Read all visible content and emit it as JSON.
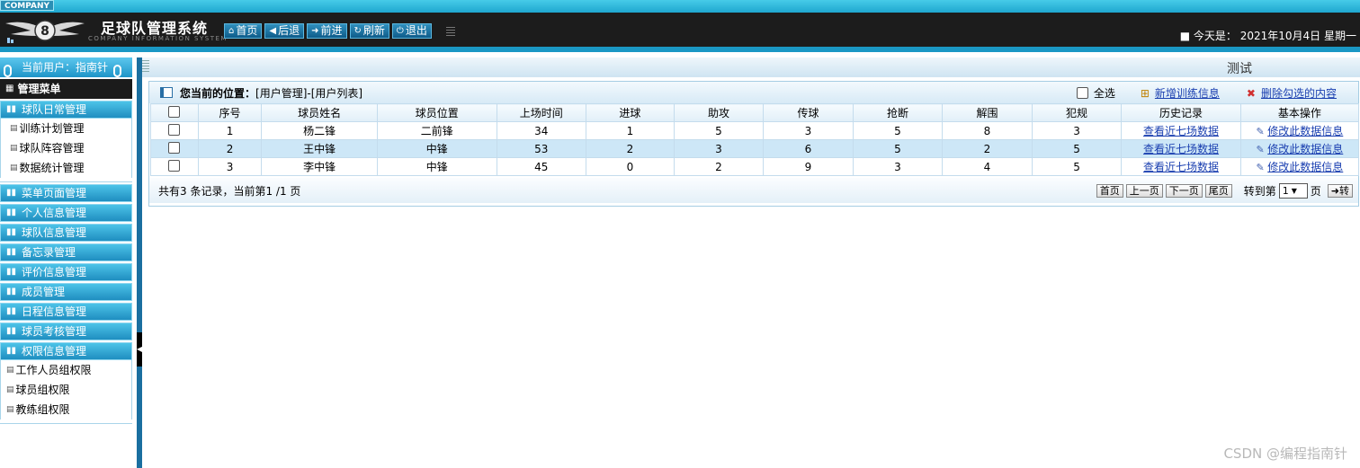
{
  "brand": {
    "company": "COMPANY",
    "title": "足球队管理系统",
    "subtitle": "COMPANY INFORMATION SYSTEM"
  },
  "nav": [
    {
      "label": "首页",
      "icon": "home-icon",
      "glyph": "⌂"
    },
    {
      "label": "后退",
      "icon": "back-icon",
      "glyph": "◀"
    },
    {
      "label": "前进",
      "icon": "forward-icon",
      "glyph": "➜"
    },
    {
      "label": "刷新",
      "icon": "refresh-icon",
      "glyph": "↻"
    },
    {
      "label": "退出",
      "icon": "power-icon",
      "glyph": "⏻"
    }
  ],
  "today": "■ 今天是：  2021年10月4日 星期一",
  "sidebar": {
    "user": "当前用户：指南针",
    "menu_title": "管理菜单",
    "sections": [
      {
        "label": "球队日常管理",
        "items": [
          "训练计划管理",
          "球队阵容管理",
          "数据统计管理"
        ]
      },
      {
        "label": "菜单页面管理",
        "items": []
      },
      {
        "label": "个人信息管理",
        "items": []
      },
      {
        "label": "球队信息管理",
        "items": []
      },
      {
        "label": "备忘录管理",
        "items": []
      },
      {
        "label": "评价信息管理",
        "items": []
      },
      {
        "label": "成员管理",
        "items": []
      },
      {
        "label": "日程信息管理",
        "items": []
      },
      {
        "label": "球员考核管理",
        "items": []
      },
      {
        "label": "权限信息管理",
        "items": [
          "工作人员组权限",
          "球员组权限",
          "教练组权限"
        ]
      }
    ]
  },
  "page": {
    "heading": "测试"
  },
  "position": {
    "label": "您当前的位置：",
    "path": "[用户管理]-[用户列表]"
  },
  "tools": {
    "select_all": "全选",
    "add": "新增训练信息",
    "delete": "删除勾选的内容"
  },
  "table": {
    "headers": [
      "序号",
      "球员姓名",
      "球员位置",
      "上场时间",
      "进球",
      "助攻",
      "传球",
      "抢断",
      "解围",
      "犯规",
      "历史记录",
      "基本操作"
    ],
    "rows": [
      [
        "1",
        "杨二锋",
        "二前锋",
        "34",
        "1",
        "5",
        "3",
        "5",
        "8",
        "3"
      ],
      [
        "2",
        "王中锋",
        "中锋",
        "53",
        "2",
        "3",
        "6",
        "5",
        "2",
        "5"
      ],
      [
        "3",
        "李中锋",
        "中锋",
        "45",
        "0",
        "2",
        "9",
        "3",
        "4",
        "5"
      ]
    ],
    "history_link": "查看近七场数据",
    "edit_link": "修改此数据信息"
  },
  "footer": {
    "summary": "共有3 条记录，当前第1 /1 页",
    "first": "首页",
    "prev": "上一页",
    "next": "下一页",
    "last": "尾页",
    "goto": "转到第",
    "page_value": "1",
    "page_unit": "页",
    "go": "➜转"
  },
  "watermark": "CSDN @编程指南针"
}
